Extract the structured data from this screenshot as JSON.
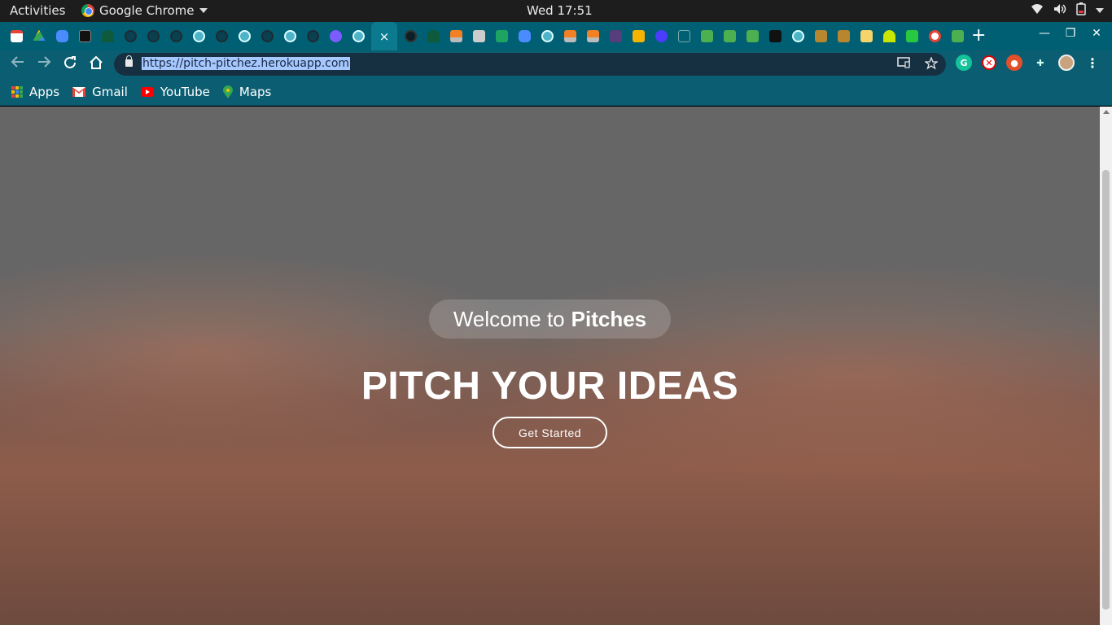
{
  "system_bar": {
    "activities": "Activities",
    "app_name": "Google Chrome",
    "clock": "Wed 17:51"
  },
  "browser": {
    "url": "https://pitch-pitchez.herokuapp.com",
    "active_tab_close": "×",
    "new_tab": "+",
    "tab_favicons": [
      "gmail-icon",
      "drive-icon",
      "zoom-icon",
      "notion-icon",
      "tree-icon",
      "github-icon",
      "github-icon",
      "github-icon",
      "globe-icon",
      "github-icon",
      "globe-icon",
      "github-icon",
      "globe-icon",
      "github-icon",
      "bot-icon",
      "globe-icon"
    ],
    "right_tab_favicons": [
      "globe-icon",
      "tree-icon",
      "stackoverflow-icon",
      "robot-icon",
      "plus-icon",
      "zoom-icon",
      "globe-icon",
      "stackoverflow-icon",
      "stackoverflow-icon",
      "bootstrap-icon",
      "slides-icon",
      "f-icon",
      "feather-icon",
      "w3-icon",
      "w3-icon",
      "w3-icon",
      "s-icon",
      "globe-icon",
      "book-icon",
      "book-icon",
      "folder-icon",
      "signal-icon",
      "px-icon",
      "google-icon",
      "w3-icon"
    ]
  },
  "bookmarks": [
    {
      "label": "Apps"
    },
    {
      "label": "Gmail"
    },
    {
      "label": "YouTube"
    },
    {
      "label": "Maps"
    }
  ],
  "hero": {
    "welcome_prefix": "Welcome to",
    "welcome_brand": "Pitches",
    "headline": "PITCH YOUR IDEAS",
    "cta": "Get Started"
  },
  "colors": {
    "tabstrip": "#005f73",
    "toolbar": "#0b5e72",
    "hero_top": "#666666",
    "hero_bottom": "#6d4a3e"
  }
}
